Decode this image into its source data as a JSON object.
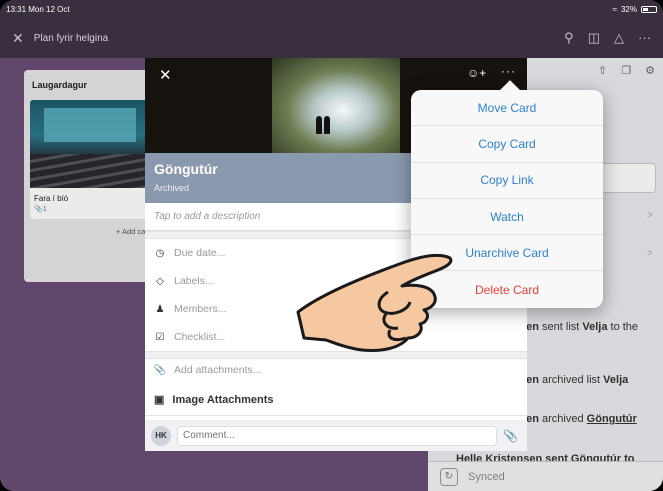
{
  "status": {
    "time": "13:31",
    "date": "Mon 12 Oct",
    "battery": "32%"
  },
  "topbar": {
    "board_title": "Plan fyrir helgina"
  },
  "list": {
    "title": "Laugardagur",
    "card_title": "Fara í bíó",
    "card_meta": "1",
    "add_card": "+ Add card"
  },
  "modal": {
    "card_title": "Göngutúr",
    "status": "Archived",
    "description_placeholder": "Tap to add a description",
    "fields": {
      "due": "Due date...",
      "labels": "Labels...",
      "members": "Members...",
      "checklist": "Checklist..."
    },
    "add_attachments": "Add attachments...",
    "image_attachments": "Image Attachments",
    "comment_avatar": "HK",
    "comment_placeholder": "Comment..."
  },
  "menu": {
    "items": [
      {
        "label": "Move Card",
        "color": "#2f7fd1"
      },
      {
        "label": "Copy Card",
        "color": "#2f7fd1"
      },
      {
        "label": "Copy Link",
        "color": "#2f7fd1"
      },
      {
        "label": "Watch",
        "color": "#2f7fd1"
      },
      {
        "label": "Unarchive Card",
        "color": "#2f7fd1"
      },
      {
        "label": "Delete Card",
        "color": "#e8403b"
      }
    ]
  },
  "activity": {
    "a1_name": "sen",
    "a1_text": " sent list ",
    "a1_list": "Velja",
    "a1_tail": " to the",
    "a2_name": "sen",
    "a2_text": " archived list ",
    "a2_list": "Velja",
    "a3_name": "sen",
    "a3_text": " archived ",
    "a3_card": "Göngutúr",
    "a4_text": "Helle Kristensen sent Göngutúr to"
  },
  "synced": "Synced"
}
